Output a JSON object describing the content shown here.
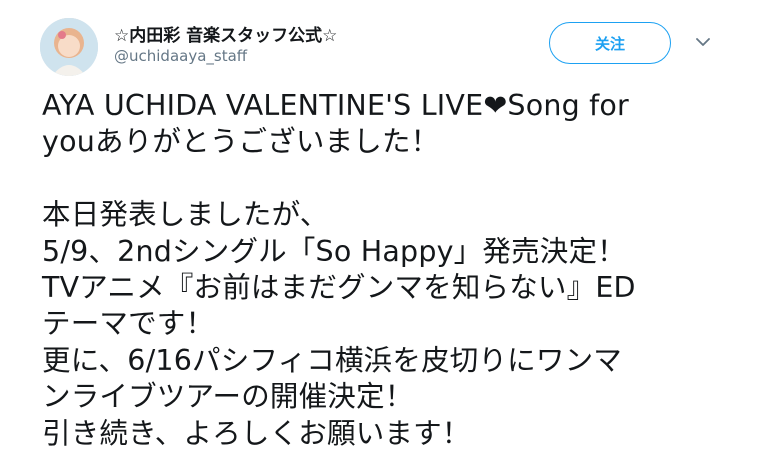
{
  "author": {
    "display_name": "☆内田彩 音楽スタッフ公式☆",
    "handle": "@uchidaaya_staff",
    "avatar_icon": "profile-avatar-icon"
  },
  "actions": {
    "follow_label": "关注",
    "menu_icon": "chevron-down-icon"
  },
  "tweet": {
    "lines": [
      "AYA UCHIDA VALENTINE'S  LIVE❤Song for",
      "youありがとうございました！",
      "",
      "本日発表しましたが、",
      "5/9、2ndシングル「So Happy」発売決定！",
      "TVアニメ『お前はまだグンマを知らない』ED",
      "テーマです！",
      "更に、6/16パシフィコ横浜を皮切りにワンマ",
      "ンライブツアーの開催決定！",
      "引き続き、よろしくお願います！"
    ]
  },
  "colors": {
    "accent": "#1da1f2",
    "text": "#14171a",
    "secondary": "#657786"
  }
}
